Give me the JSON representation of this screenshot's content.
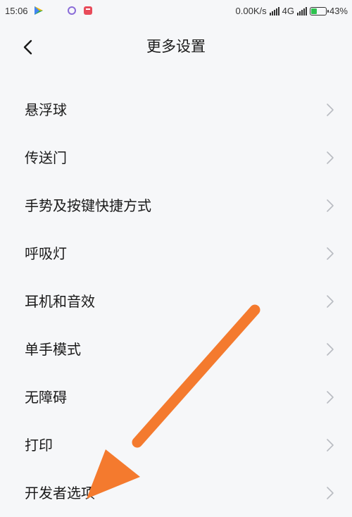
{
  "status_bar": {
    "time": "15:06",
    "network_speed": "0.00K/s",
    "network_type": "4G",
    "battery_percent": "43%",
    "battery_level": 0.43,
    "battery_color": "#2ec24f",
    "icons": [
      "play-store-icon",
      "circle-app-icon",
      "red-app-icon",
      "signal-icon",
      "signal-icon",
      "battery-icon"
    ]
  },
  "header": {
    "title": "更多设置",
    "back_icon": "chevron-left-icon"
  },
  "settings_list": [
    {
      "label": "悬浮球"
    },
    {
      "label": "传送门"
    },
    {
      "label": "手势及按键快捷方式"
    },
    {
      "label": "呼吸灯"
    },
    {
      "label": "耳机和音效"
    },
    {
      "label": "单手模式"
    },
    {
      "label": "无障碍"
    },
    {
      "label": "打印"
    },
    {
      "label": "开发者选项"
    }
  ],
  "annotation": {
    "arrow_color": "#f47a2e"
  }
}
